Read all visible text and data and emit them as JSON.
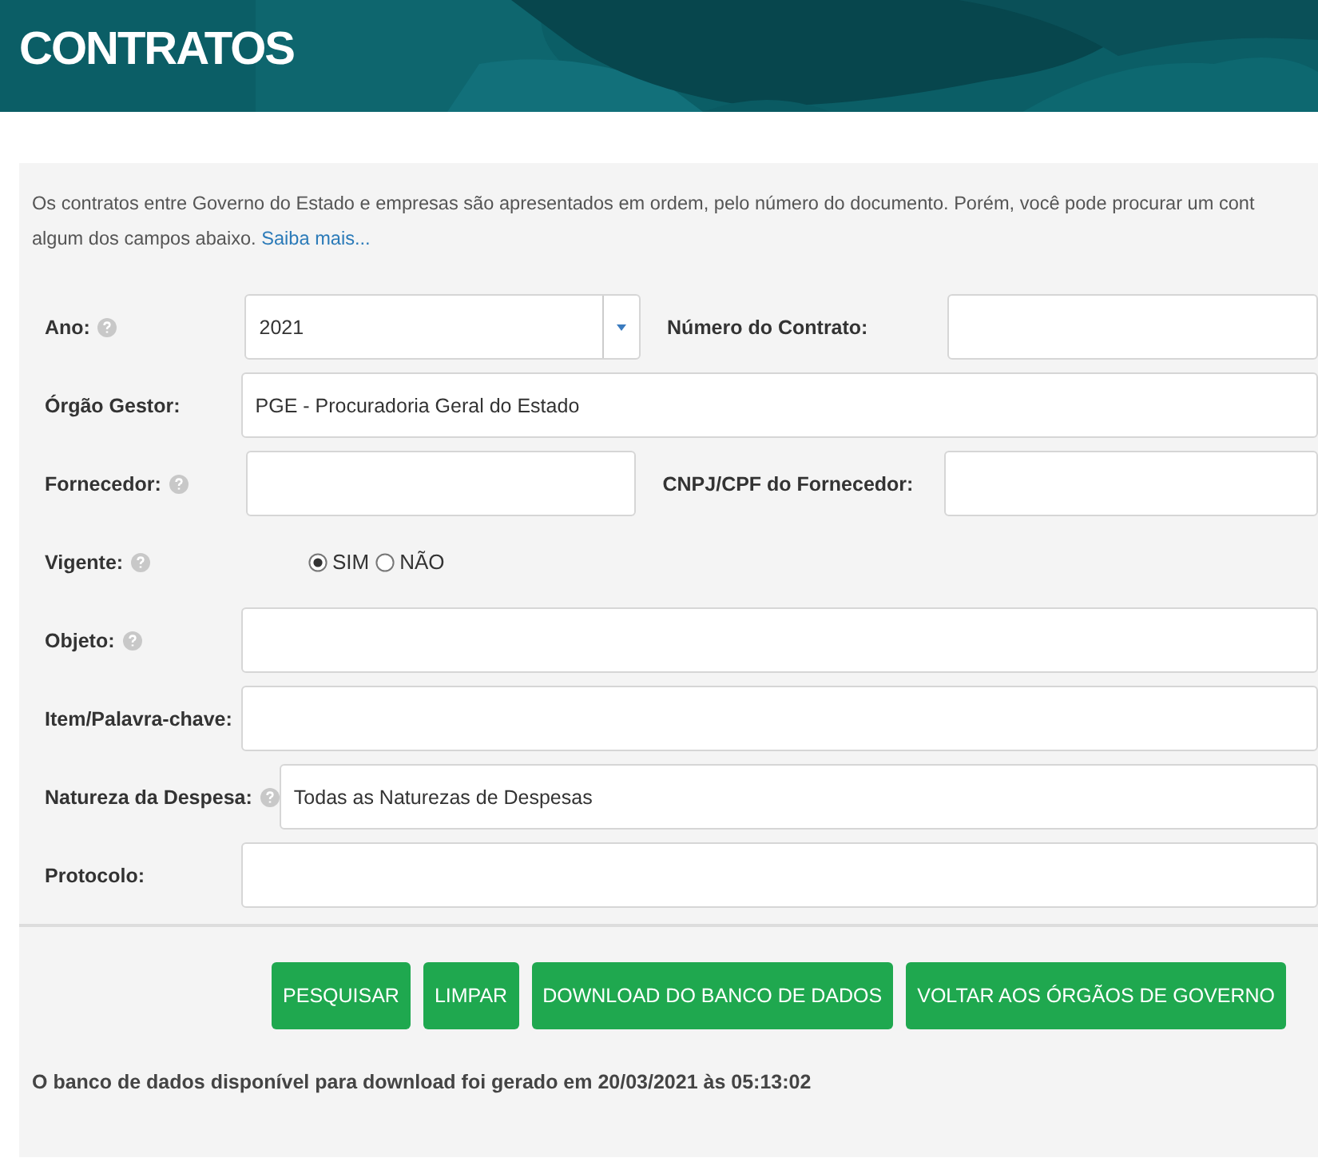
{
  "header": {
    "title": "CONTRATOS"
  },
  "intro": {
    "lines": [
      "Os contratos entre Governo do Estado e empresas são apresentados em ordem, pelo número do documento. Porém, você pode procurar um cont",
      "algum dos campos abaixo."
    ],
    "link": "Saiba mais..."
  },
  "fields": [
    {
      "label": "Ano:",
      "help": true,
      "kind": "select",
      "value": "2021",
      "side": {
        "label": "Número do Contrato:",
        "kind": "text"
      }
    },
    {
      "label": "Órgão Gestor:",
      "help": false,
      "kind": "wide",
      "value": "PGE - Procuradoria Geral do Estado"
    },
    {
      "label": "Fornecedor:",
      "help": true,
      "kind": "text",
      "side": {
        "label": "CNPJ/CPF do Fornecedor:",
        "kind": "text"
      }
    },
    {
      "label": "Vigente:",
      "help": true,
      "kind": "radio",
      "options": [
        {
          "label": "SIM",
          "selected": true
        },
        {
          "label": "NÃO",
          "selected": false
        }
      ]
    },
    {
      "label": "Objeto:",
      "help": true,
      "kind": "wide"
    },
    {
      "label": "Item/Palavra-chave:",
      "help": false,
      "kind": "wide"
    },
    {
      "label": "Natureza da Despesa:",
      "help": true,
      "kind": "wide",
      "value": "Todas as Naturezas de Despesas"
    },
    {
      "label": "Protocolo:",
      "help": false,
      "kind": "wide"
    }
  ],
  "buttons": [
    "PESQUISAR",
    "LIMPAR",
    "DOWNLOAD DO BANCO DE DADOS",
    "VOLTAR AOS ÓRGÃOS DE GOVERNO"
  ],
  "footer": "O banco de dados disponível para download foi gerado em 20/03/2021 às 05:13:02"
}
